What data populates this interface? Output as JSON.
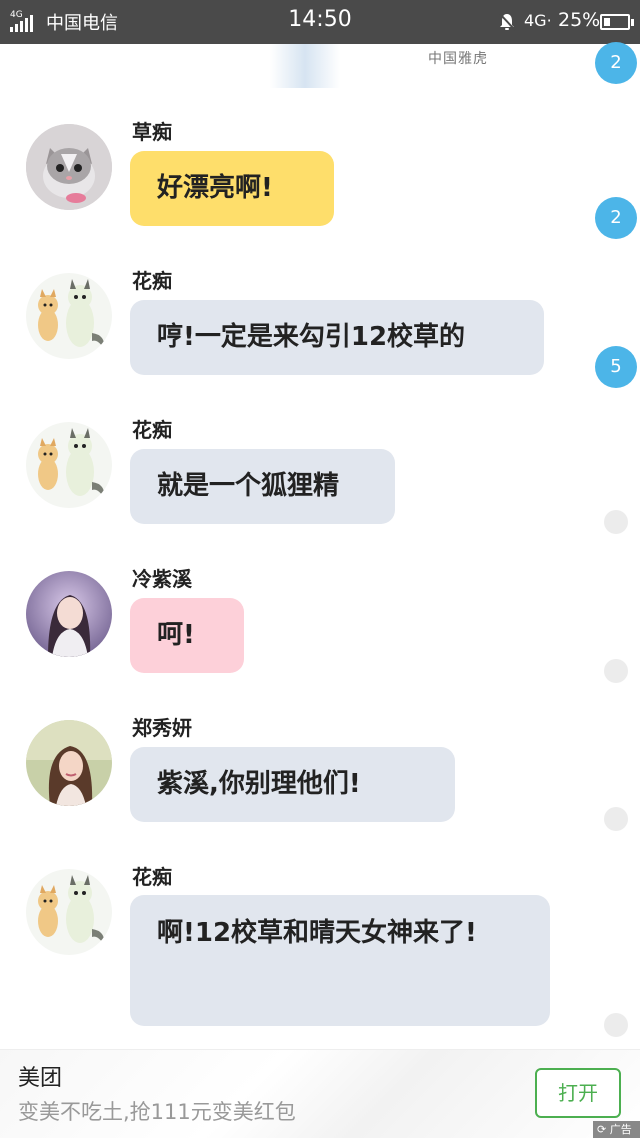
{
  "status_bar": {
    "network_type": "4G",
    "carrier": "中国电信",
    "time": "14:50",
    "network_right": "4G·",
    "battery": "25%",
    "battery_level": 0.25
  },
  "top_banner": {
    "text": "中国雅虎"
  },
  "badges": [
    "2",
    "2",
    "5"
  ],
  "messages": [
    {
      "sender": "草痴",
      "text": "好漂亮啊!",
      "avatar": "kitten-avatar-icon",
      "bubble_color": "#fede6b"
    },
    {
      "sender": "花痴",
      "text": "哼!一定是来勾引12校草的",
      "avatar": "cat-dog-cartoon-avatar-icon",
      "bubble_color": "#e1e6ee"
    },
    {
      "sender": "花痴",
      "text": "就是一个狐狸精",
      "avatar": "cat-dog-cartoon-avatar-icon",
      "bubble_color": "#e1e6ee"
    },
    {
      "sender": "冷紫溪",
      "text": "呵!",
      "avatar": "girl-photo-avatar-icon",
      "bubble_color": "#fdd0d9"
    },
    {
      "sender": "郑秀妍",
      "text": "紫溪,你别理他们!",
      "avatar": "woman-photo-avatar-icon",
      "bubble_color": "#e1e6ee"
    },
    {
      "sender": "花痴",
      "text": "啊!12校草和晴天女神来了!",
      "avatar": "cat-dog-cartoon-avatar-icon",
      "bubble_color": "#e1e6ee"
    }
  ],
  "ad": {
    "title": "美团",
    "description": "变美不吃土,抢111元变美红包",
    "button": "打开",
    "tag": "广告"
  },
  "colors": {
    "badge": "#4cb5e8",
    "ad_button": "#4caf50",
    "status_bar": "#4a4a4a"
  }
}
